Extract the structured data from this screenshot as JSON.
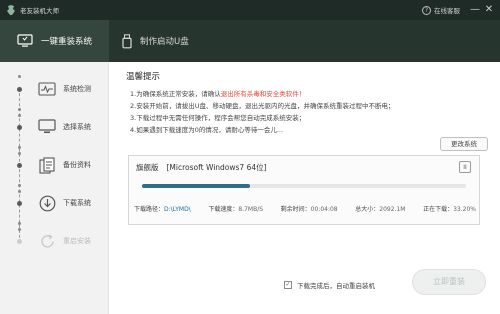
{
  "titlebar": {
    "app_title": "老友装机大师",
    "help_label": "在线客服",
    "minimize_glyph": "—",
    "close_glyph": "✕"
  },
  "nav": {
    "tabs": [
      {
        "label": "一键重装系统",
        "icon": "monitor-icon",
        "active": true
      },
      {
        "label": "制作启动U盘",
        "icon": "usb-drive-icon",
        "active": false
      }
    ]
  },
  "sidebar": {
    "steps": [
      {
        "label": "系统检测",
        "icon": "heartbeat-monitor-icon",
        "state": "done"
      },
      {
        "label": "选择系统",
        "icon": "display-icon",
        "state": "done"
      },
      {
        "label": "备份资料",
        "icon": "documents-icon",
        "state": "done"
      },
      {
        "label": "下载系统",
        "icon": "download-circle-icon",
        "state": "current"
      },
      {
        "label": "重启安装",
        "icon": "restart-icon",
        "state": "pending"
      }
    ]
  },
  "main": {
    "notice_title": "温馨提示",
    "notices": [
      {
        "pre": "1.为确保系统正常安装，请确认",
        "red": "退出所有杀毒和安全类软件！",
        "post": ""
      },
      {
        "pre": "2.安装开始前，请拔出U盘、移动硬盘，退出光驱内的光盘，并确保系统重装过程中不断电；",
        "red": "",
        "post": ""
      },
      {
        "pre": "3.下载过程中无需任何操作，程序会帮您自动完成系统安装；",
        "red": "",
        "post": ""
      },
      {
        "pre": "4.如果遇到下载速度为0的情况，请耐心等待一会儿...",
        "red": "",
        "post": ""
      }
    ],
    "change_system_label": "更改系统",
    "task": {
      "edition": "旗舰版",
      "system_name": "[Microsoft Windows7 64位]",
      "pause_glyph": "II",
      "progress": 0.332,
      "stats": {
        "path_label": "下载路径：",
        "path_value": "D:\\LYMD\\",
        "speed_label": "下载速度：",
        "speed_value": "8.7MB/S",
        "remain_label": "剩余时间：",
        "remain_value": "00:04:08",
        "size_label": "总大小：",
        "size_value": "2092.1M",
        "status_label": "正在下载：",
        "status_value": "33.20%"
      }
    },
    "auto_restart_label": "下载完成后，自动重启装机",
    "auto_restart_checked": true,
    "reinstall_label": "立即重装"
  },
  "colors": {
    "titlebar_bg": "#1f2b26",
    "nav_bg": "#27352f",
    "active_tab_bg": "#34463d",
    "progress_fill": "#2f6f88",
    "warning_red": "#e04a3a"
  }
}
